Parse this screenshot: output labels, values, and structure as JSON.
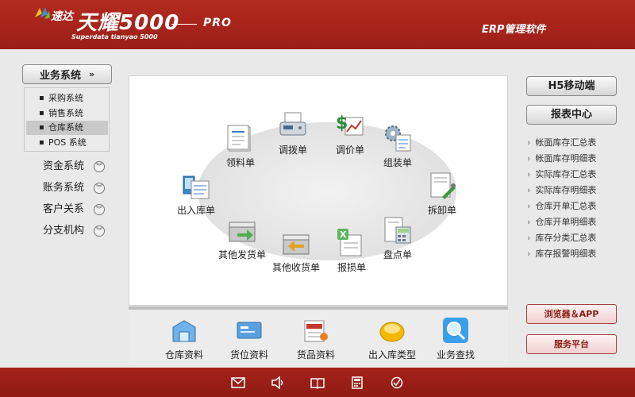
{
  "header": {
    "brand_small": "速达",
    "brand_big": "天耀5000",
    "brand_pro": "PRO",
    "brand_en": "Superdata tianyao 5000",
    "product": "ERP管理软件"
  },
  "sidebar": {
    "system_button": "业务系统",
    "sub_items": [
      {
        "label": "采购系统"
      },
      {
        "label": "销售系统"
      },
      {
        "label": "仓库系统"
      },
      {
        "label": "POS 系统"
      }
    ],
    "items": [
      {
        "label": "资金系统"
      },
      {
        "label": "账务系统"
      },
      {
        "label": "客户关系"
      },
      {
        "label": "分支机构"
      }
    ]
  },
  "flow": {
    "nodes": [
      {
        "label": "领料单",
        "icon": "material-requisition-icon"
      },
      {
        "label": "调拨单",
        "icon": "fax-transfer-icon"
      },
      {
        "label": "调价单",
        "icon": "price-adjust-icon"
      },
      {
        "label": "组装单",
        "icon": "assembly-gear-icon"
      },
      {
        "label": "出入库单",
        "icon": "stock-inout-icon"
      },
      {
        "label": "拆卸单",
        "icon": "disassembly-tool-icon"
      },
      {
        "label": "其他发货单",
        "icon": "other-delivery-icon"
      },
      {
        "label": "其他收货单",
        "icon": "other-receipt-icon"
      },
      {
        "label": "报损单",
        "icon": "damage-report-icon"
      },
      {
        "label": "盘点单",
        "icon": "stocktake-calculator-icon"
      }
    ]
  },
  "bottom": {
    "items": [
      {
        "label": "仓库资料",
        "icon": "warehouse-data-icon"
      },
      {
        "label": "货位资料",
        "icon": "location-card-icon"
      },
      {
        "label": "货品资料",
        "icon": "goods-data-icon"
      },
      {
        "label": "出入库类型",
        "icon": "inout-type-icon"
      },
      {
        "label": "业务查找",
        "icon": "search-icon"
      }
    ]
  },
  "right": {
    "h5_button": "H5移动端",
    "report_button": "报表中心",
    "reports": [
      {
        "label": "帐面库存汇总表"
      },
      {
        "label": "帐面库存明细表"
      },
      {
        "label": "实际库存汇总表"
      },
      {
        "label": "实际库存明细表"
      },
      {
        "label": "仓库开单汇总表"
      },
      {
        "label": "仓库开单明细表"
      },
      {
        "label": "库存分类汇总表"
      },
      {
        "label": "库存报警明细表"
      }
    ],
    "browser_button": "浏览器＆APP",
    "service_button": "服务平台"
  },
  "footer": {
    "icons": [
      "mail-icon",
      "speaker-icon",
      "book-icon",
      "calculator-icon",
      "check-icon"
    ]
  },
  "colors": {
    "brand_red": "#a52219",
    "panel_white": "#ffffff"
  }
}
